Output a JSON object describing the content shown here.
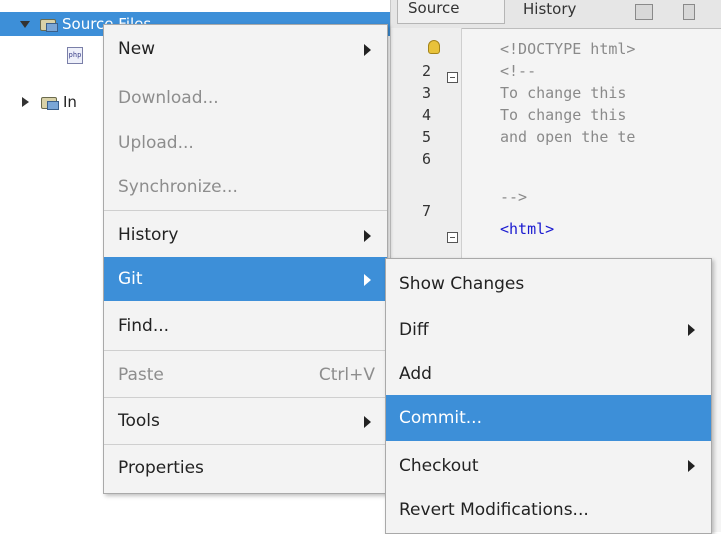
{
  "tree": {
    "root_label": "Source Files",
    "file_icon_text": "php",
    "other_node_label": "In"
  },
  "editor": {
    "tabs": [
      "Source",
      "History"
    ],
    "line_numbers": [
      "2",
      "3",
      "4",
      "5",
      "6",
      "7"
    ],
    "lines": [
      "<!DOCTYPE html>",
      "<!--",
      "To change this",
      "To change this",
      "and open the te",
      "-->",
      "<html>"
    ]
  },
  "context_menu": {
    "items": [
      {
        "label": "New",
        "has_submenu": true,
        "enabled": true
      },
      {
        "label": "Download...",
        "enabled": false
      },
      {
        "label": "Upload...",
        "enabled": false
      },
      {
        "label": "Synchronize...",
        "enabled": false
      },
      {
        "label": "History",
        "has_submenu": true,
        "enabled": true
      },
      {
        "label": "Git",
        "has_submenu": true,
        "enabled": true,
        "active": true
      },
      {
        "label": "Find...",
        "enabled": true
      },
      {
        "label": "Paste",
        "shortcut": "Ctrl+V",
        "enabled": false
      },
      {
        "label": "Tools",
        "has_submenu": true,
        "enabled": true
      },
      {
        "label": "Properties",
        "enabled": true
      }
    ]
  },
  "git_submenu": {
    "items": [
      {
        "label": "Show Changes"
      },
      {
        "label": "Diff",
        "has_submenu": true
      },
      {
        "label": "Add"
      },
      {
        "label": "Commit...",
        "active": true
      },
      {
        "label": "Checkout",
        "has_submenu": true
      },
      {
        "label": "Revert Modifications..."
      }
    ]
  },
  "colors": {
    "selection": "#3d8fd8",
    "menu_bg": "#f3f3f3",
    "disabled_text": "#8d8d8d",
    "code_comment": "#8a8a8a",
    "code_tag": "#1a1ad0"
  }
}
